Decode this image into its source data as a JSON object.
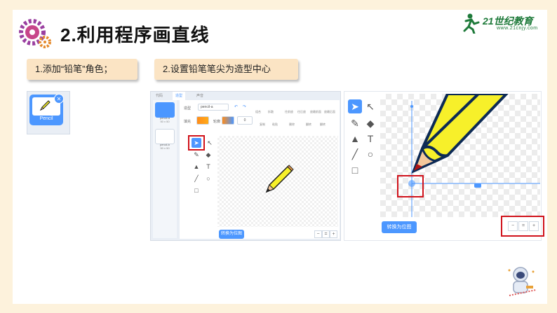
{
  "header": {
    "title": "2.利用程序画直线",
    "logo_text": "21世纪教育",
    "logo_sub": "www.21cnjy.com"
  },
  "steps": [
    {
      "label": "1.添加“铅笔”角色；"
    },
    {
      "label": "2.设置铅笔笔尖为造型中心"
    }
  ],
  "sprite": {
    "name": "Pencil"
  },
  "editor": {
    "tabs": [
      "代码",
      "造型",
      "声音"
    ],
    "costumes": [
      {
        "name": "pencil-a",
        "size": "50 x 50"
      },
      {
        "name": "pencil-b",
        "size": "50 x 50"
      }
    ],
    "name_label": "造型",
    "name_value": "pencil-a",
    "fill_label": "填充",
    "outline_label": "轮廓",
    "outline_value": "0",
    "toolbar": [
      "组合",
      "拆散",
      "往前放",
      "往后放",
      "放最前面",
      "放最后面",
      "复制",
      "粘贴",
      "删除",
      "翻转",
      "翻转"
    ],
    "convert_button": "转换为位图"
  },
  "zoom_view": {
    "convert_button": "转换为位图"
  },
  "colors": {
    "accent": "#4c97ff",
    "highlight": "#d0121b",
    "step_bg": "#fbe4c4",
    "page_bg": "#fdf2dc",
    "logo_green": "#1e7a3a",
    "pencil_yellow": "#f7f02a"
  }
}
